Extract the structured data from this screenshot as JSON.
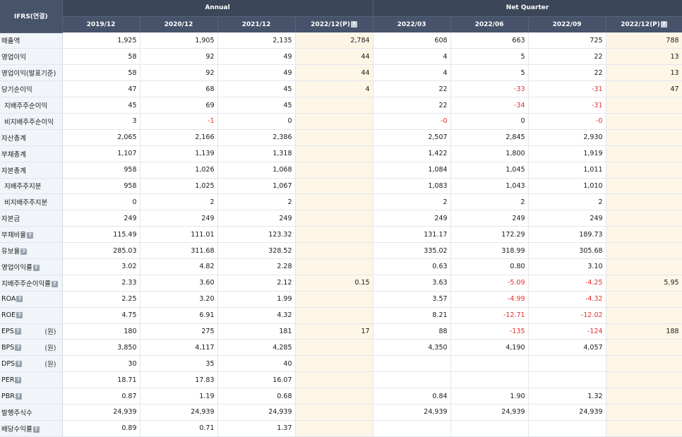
{
  "header": {
    "corner_label": "IFRS(연결)",
    "groups": [
      "Annual",
      "Net Quarter"
    ],
    "columns": [
      "2019/12",
      "2020/12",
      "2021/12",
      "2022/12(P)",
      "2022/03",
      "2022/06",
      "2022/09",
      "2022/12(P)"
    ],
    "info_icon": "?"
  },
  "rows": [
    {
      "label": "매출액",
      "indent": false,
      "help": false,
      "unit": "",
      "values": [
        "1,925",
        "1,905",
        "2,135",
        "2,784",
        "608",
        "663",
        "725",
        "788"
      ]
    },
    {
      "label": "영업이익",
      "indent": false,
      "help": false,
      "unit": "",
      "values": [
        "58",
        "92",
        "49",
        "44",
        "4",
        "5",
        "22",
        "13"
      ]
    },
    {
      "label": "영업이익(발표기준)",
      "indent": false,
      "help": false,
      "unit": "",
      "values": [
        "58",
        "92",
        "49",
        "44",
        "4",
        "5",
        "22",
        "13"
      ]
    },
    {
      "label": "당기순이익",
      "indent": false,
      "help": false,
      "unit": "",
      "values": [
        "47",
        "68",
        "45",
        "4",
        "22",
        "-33",
        "-31",
        "47"
      ]
    },
    {
      "label": "지배주주순이익",
      "indent": true,
      "help": false,
      "unit": "",
      "values": [
        "45",
        "69",
        "45",
        "",
        "22",
        "-34",
        "-31",
        ""
      ]
    },
    {
      "label": "비지배주주순이익",
      "indent": true,
      "help": false,
      "unit": "",
      "values": [
        "3",
        "-1",
        "0",
        "",
        "-0",
        "0",
        "-0",
        ""
      ]
    },
    {
      "label": "자산총계",
      "indent": false,
      "help": false,
      "unit": "",
      "values": [
        "2,065",
        "2,166",
        "2,386",
        "",
        "2,507",
        "2,845",
        "2,930",
        ""
      ]
    },
    {
      "label": "부채총계",
      "indent": false,
      "help": false,
      "unit": "",
      "values": [
        "1,107",
        "1,139",
        "1,318",
        "",
        "1,422",
        "1,800",
        "1,919",
        ""
      ]
    },
    {
      "label": "자본총계",
      "indent": false,
      "help": false,
      "unit": "",
      "values": [
        "958",
        "1,026",
        "1,068",
        "",
        "1,084",
        "1,045",
        "1,011",
        ""
      ]
    },
    {
      "label": "지배주주지분",
      "indent": true,
      "help": false,
      "unit": "",
      "values": [
        "958",
        "1,025",
        "1,067",
        "",
        "1,083",
        "1,043",
        "1,010",
        ""
      ]
    },
    {
      "label": "비지배주주지분",
      "indent": true,
      "help": false,
      "unit": "",
      "values": [
        "0",
        "2",
        "2",
        "",
        "2",
        "2",
        "2",
        ""
      ]
    },
    {
      "label": "자본금",
      "indent": false,
      "help": false,
      "unit": "",
      "values": [
        "249",
        "249",
        "249",
        "",
        "249",
        "249",
        "249",
        ""
      ]
    },
    {
      "label": "부채비율",
      "indent": false,
      "help": true,
      "unit": "",
      "values": [
        "115.49",
        "111.01",
        "123.32",
        "",
        "131.17",
        "172.29",
        "189.73",
        ""
      ]
    },
    {
      "label": "유보율",
      "indent": false,
      "help": true,
      "unit": "",
      "values": [
        "285.03",
        "311.68",
        "328.52",
        "",
        "335.02",
        "318.99",
        "305.68",
        ""
      ]
    },
    {
      "label": "영업이익률",
      "indent": false,
      "help": true,
      "unit": "",
      "values": [
        "3.02",
        "4.82",
        "2.28",
        "",
        "0.63",
        "0.80",
        "3.10",
        ""
      ]
    },
    {
      "label": "지배주주순이익률",
      "indent": false,
      "help": true,
      "unit": "",
      "values": [
        "2.33",
        "3.60",
        "2.12",
        "0.15",
        "3.63",
        "-5.09",
        "-4.25",
        "5.95"
      ]
    },
    {
      "label": "ROA",
      "indent": false,
      "help": true,
      "unit": "",
      "values": [
        "2.25",
        "3.20",
        "1.99",
        "",
        "3.57",
        "-4.99",
        "-4.32",
        ""
      ]
    },
    {
      "label": "ROE",
      "indent": false,
      "help": true,
      "unit": "",
      "values": [
        "4.75",
        "6.91",
        "4.32",
        "",
        "8.21",
        "-12.71",
        "-12.02",
        ""
      ]
    },
    {
      "label": "EPS",
      "indent": false,
      "help": true,
      "unit": "(원)",
      "values": [
        "180",
        "275",
        "181",
        "17",
        "88",
        "-135",
        "-124",
        "188"
      ]
    },
    {
      "label": "BPS",
      "indent": false,
      "help": true,
      "unit": "(원)",
      "values": [
        "3,850",
        "4,117",
        "4,285",
        "",
        "4,350",
        "4,190",
        "4,057",
        ""
      ]
    },
    {
      "label": "DPS",
      "indent": false,
      "help": true,
      "unit": "(원)",
      "values": [
        "30",
        "35",
        "40",
        "",
        "",
        "",
        "",
        ""
      ]
    },
    {
      "label": "PER",
      "indent": false,
      "help": true,
      "unit": "",
      "values": [
        "18.71",
        "17.83",
        "16.07",
        "",
        "",
        "",
        "",
        ""
      ]
    },
    {
      "label": "PBR",
      "indent": false,
      "help": true,
      "unit": "",
      "values": [
        "0.87",
        "1.19",
        "0.68",
        "",
        "0.84",
        "1.90",
        "1.32",
        ""
      ]
    },
    {
      "label": "발행주식수",
      "indent": false,
      "help": false,
      "unit": "",
      "values": [
        "24,939",
        "24,939",
        "24,939",
        "",
        "24,939",
        "24,939",
        "24,939",
        ""
      ]
    },
    {
      "label": "배당수익률",
      "indent": false,
      "help": true,
      "unit": "",
      "values": [
        "0.89",
        "0.71",
        "1.37",
        "",
        "",
        "",
        "",
        ""
      ]
    }
  ],
  "colors": {
    "header": "#3b4759",
    "estimate_bg": "#fdf6e6",
    "negative": "#e0322b",
    "label_bg": "#f1f4f9"
  }
}
